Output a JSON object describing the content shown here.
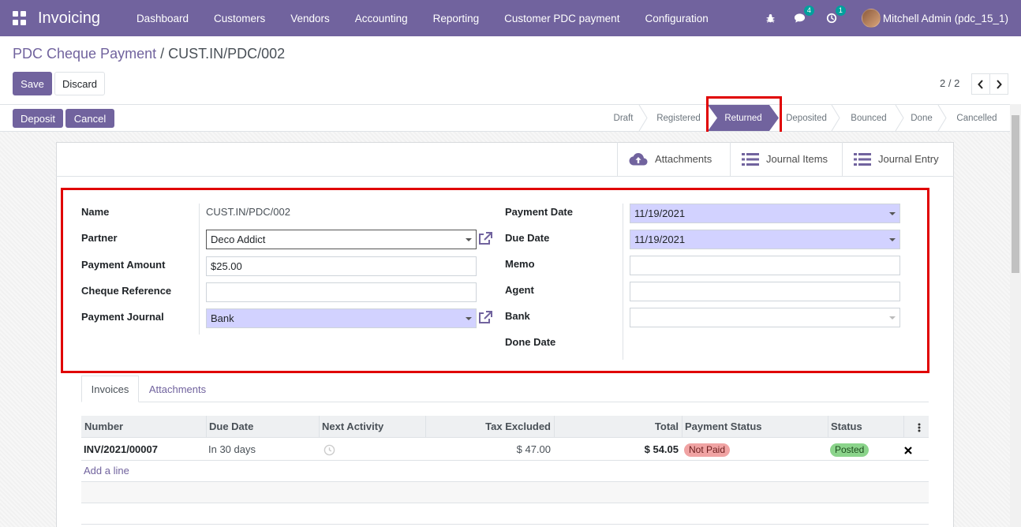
{
  "app": {
    "title": "Invoicing",
    "menu": [
      "Dashboard",
      "Customers",
      "Vendors",
      "Accounting",
      "Reporting",
      "Customer PDC payment",
      "Configuration"
    ],
    "messages_count": "4",
    "activities_count": "1",
    "user": "Mitchell Admin (pdc_15_1)"
  },
  "breadcrumb": {
    "parent": "PDC Cheque Payment",
    "separator": "/",
    "current": "CUST.IN/PDC/002"
  },
  "actions": {
    "save": "Save",
    "discard": "Discard",
    "pager": "2 / 2"
  },
  "statusbar": {
    "buttons": [
      "Deposit",
      "Cancel"
    ],
    "stages": [
      "Draft",
      "Registered",
      "Returned",
      "Deposited",
      "Bounced",
      "Done",
      "Cancelled"
    ],
    "active_stage": "Returned"
  },
  "smart_buttons": {
    "attachments": "Attachments",
    "journal_items": "Journal Items",
    "journal_entry": "Journal Entry"
  },
  "form": {
    "left": {
      "name_label": "Name",
      "name_value": "CUST.IN/PDC/002",
      "partner_label": "Partner",
      "partner_value": "Deco Addict",
      "amount_label": "Payment Amount",
      "amount_value": "$25.00",
      "cheque_label": "Cheque Reference",
      "cheque_value": "",
      "journal_label": "Payment Journal",
      "journal_value": "Bank"
    },
    "right": {
      "payment_date_label": "Payment Date",
      "payment_date_value": "11/19/2021",
      "due_date_label": "Due Date",
      "due_date_value": "11/19/2021",
      "memo_label": "Memo",
      "memo_value": "",
      "agent_label": "Agent",
      "agent_value": "",
      "bank_label": "Bank",
      "bank_value": "",
      "done_date_label": "Done Date"
    }
  },
  "tabs": [
    "Invoices",
    "Attachments"
  ],
  "table": {
    "columns": [
      "Number",
      "Due Date",
      "Next Activity",
      "Tax Excluded",
      "Total",
      "Payment Status",
      "Status"
    ],
    "rows": [
      {
        "number": "INV/2021/00007",
        "due_date": "In 30 days",
        "tax_excluded": "$ 47.00",
        "total": "$ 54.05",
        "payment_status": "Not Paid",
        "status": "Posted"
      }
    ],
    "add_line": "Add a line"
  },
  "colors": {
    "brand": "#71639e",
    "required_field": "#d2d2ff",
    "highlight": "#e00000",
    "not_paid": "#f0a3a3",
    "posted": "#8bd48b"
  }
}
